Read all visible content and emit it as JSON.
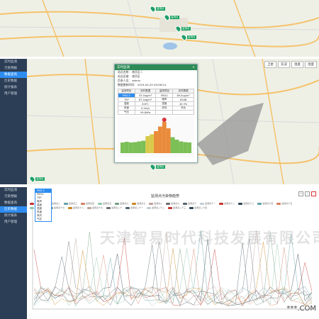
{
  "colors": {
    "sidebar_bg": "#2c3e55",
    "active": "#2d8cf0",
    "marker": "#16a05d",
    "popup_head": "#2e8b57"
  },
  "sidebar": {
    "items": [
      "实时监测",
      "污染预报",
      "数据查询",
      "历史数据",
      "统计报表",
      "用户管理"
    ],
    "active_index_top": 2,
    "active_index_bottom": 3
  },
  "map_controls": {
    "buttons": [
      "卫星",
      "实况",
      "温度",
      "湿度"
    ]
  },
  "markers": [
    {
      "label": "监测点",
      "icon": "location-pin-icon"
    },
    {
      "label": "监测点",
      "icon": "location-pin-icon"
    },
    {
      "label": "监测点",
      "icon": "location-pin-icon"
    },
    {
      "label": "监测点",
      "icon": "location-pin-icon"
    },
    {
      "label": "监测点",
      "icon": "location-pin-icon"
    },
    {
      "label": "监测点",
      "icon": "location-pin-icon"
    }
  ],
  "popup": {
    "title": "实时监测",
    "close": "×",
    "info": [
      "站点名称：  南开区二",
      "站点区域：  南开区",
      "负责人员：  admin",
      "数据更新时间：  2019-04-25 09:58:24"
    ],
    "table_head": [
      "监测项目",
      "实时数据",
      "监测项目",
      "实时数据"
    ],
    "rows": [
      [
        "PM2.5",
        "53.0ug/m³",
        "PM10",
        "89.0ug/m³"
      ],
      [
        "TSP",
        "87.0ug/m³",
        "噪声",
        "62dB"
      ],
      [
        "温度",
        "8.6℃",
        "湿度",
        "40.3%"
      ],
      [
        "风速",
        "0.5m/s",
        "风向",
        "东北"
      ],
      [
        "气压",
        "99.8kPa",
        "",
        ""
      ]
    ]
  },
  "popup_chart": {
    "values": [
      30,
      32,
      30,
      31,
      33,
      35,
      48,
      53,
      62,
      75,
      88,
      70,
      45,
      38,
      33,
      31,
      30
    ]
  },
  "bottom_chart": {
    "title": "监测点污染物趋势",
    "dropdown": [
      "PM2.5",
      "PM10",
      "TSP",
      "噪声",
      "温度",
      "湿度",
      "风速",
      "风向",
      "气压"
    ],
    "selected": "PM2.5",
    "legend": [
      "监测点一",
      "监测点二",
      "监测点三",
      "监测点四",
      "监测点五",
      "监测点六",
      "监测点七",
      "监测点八",
      "监测点九",
      "监测点十",
      "监测点十一",
      "监测点十二",
      "监测点十三",
      "监测点十四",
      "监测点十五",
      "监测点十六",
      "监测点十七",
      "监测点十八",
      "监测点十九",
      "监测点二十",
      "监测点二十一",
      "监测点二十二",
      "监测点二十三",
      "监测点二十四"
    ],
    "tools": [
      "↺",
      "⤓",
      "⛶"
    ],
    "watermark": "天津智易时代科技发展有限公司",
    "stamp": "***.COM"
  }
}
